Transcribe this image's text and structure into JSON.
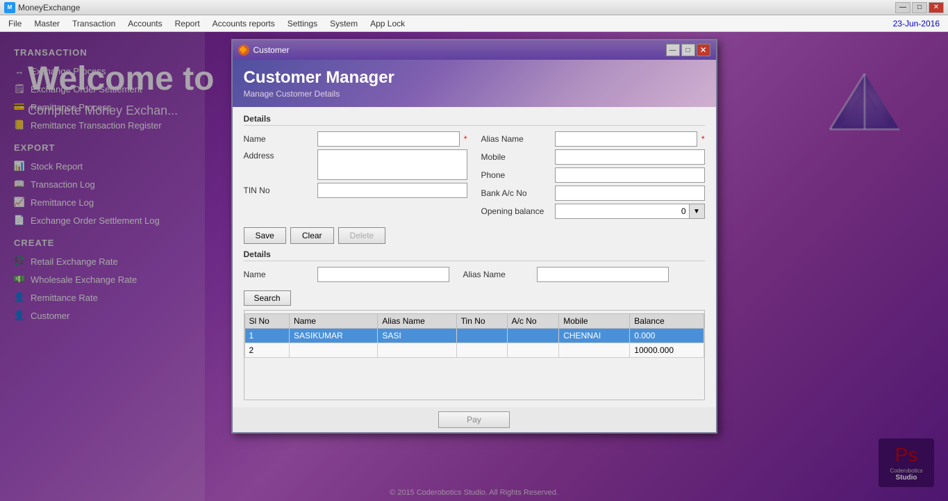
{
  "titlebar": {
    "title": "MoneyExchange",
    "minimize_label": "—",
    "maximize_label": "□",
    "close_label": "✕"
  },
  "menubar": {
    "items": [
      "File",
      "Master",
      "Transaction",
      "Accounts",
      "Report",
      "Accounts reports",
      "Settings",
      "System",
      "App Lock"
    ],
    "date": "23-Jun-2016"
  },
  "welcome": {
    "heading": "Welcome to",
    "subheading": "Complete Money Exchan..."
  },
  "sidebar": {
    "transaction_title": "TRANSACTION",
    "transaction_items": [
      {
        "label": "Exchange Process",
        "icon": "↔"
      },
      {
        "label": "Exchange Order Settlement",
        "icon": "📋"
      },
      {
        "label": "Remittance Process",
        "icon": "💳"
      },
      {
        "label": "Remittance Transaction Register",
        "icon": "📒"
      }
    ],
    "export_title": "EXPORT",
    "export_items": [
      {
        "label": "Stock Report",
        "icon": "📊"
      },
      {
        "label": "Transaction Log",
        "icon": "📖"
      },
      {
        "label": "Remittance Log",
        "icon": "📈"
      },
      {
        "label": "Exchange Order Settlement Log",
        "icon": "📄"
      }
    ],
    "create_title": "CREATE",
    "create_items": [
      {
        "label": "Retail Exchange Rate",
        "icon": "💱"
      },
      {
        "label": "Wholesale Exchange Rate",
        "icon": "💵"
      },
      {
        "label": "Remittance Rate",
        "icon": "👤"
      },
      {
        "label": "Customer",
        "icon": "👤"
      }
    ]
  },
  "footer": "© 2015 Coderobotics Studio. All Rights Reserved.",
  "dialog": {
    "title": "Customer",
    "header_title": "Customer Manager",
    "header_subtitle": "Manage Customer Details",
    "details_label": "Details",
    "fields": {
      "name_label": "Name",
      "name_value": "",
      "alias_name_label": "Alias Name",
      "alias_name_value": "",
      "address_label": "Address",
      "address_value": "",
      "mobile_label": "Mobile",
      "mobile_value": "",
      "phone_label": "Phone",
      "phone_value": "",
      "tin_no_label": "TIN No",
      "tin_no_value": "",
      "bank_ac_label": "Bank A/c No",
      "bank_ac_value": "",
      "opening_balance_label": "Opening balance",
      "opening_balance_value": "0"
    },
    "buttons": {
      "save": "Save",
      "clear": "Clear",
      "delete": "Delete"
    },
    "search_section": {
      "details_label": "Details",
      "name_label": "Name",
      "alias_name_label": "Alias Name",
      "search_btn": "Search"
    },
    "table": {
      "columns": [
        "Sl No",
        "Name",
        "Alias Name",
        "Tin No",
        "A/c No",
        "Mobile",
        "Balance"
      ],
      "rows": [
        {
          "sl": "1",
          "name": "SASIKUMAR",
          "alias": "SASI",
          "tin": "",
          "ac": "",
          "mobile": "CHENNAI",
          "balance": "0.000",
          "selected": true
        },
        {
          "sl": "2",
          "name": "",
          "alias": "",
          "tin": "",
          "ac": "",
          "mobile": "",
          "balance": "10000.000",
          "selected": false
        }
      ]
    },
    "pay_btn": "Pay"
  }
}
